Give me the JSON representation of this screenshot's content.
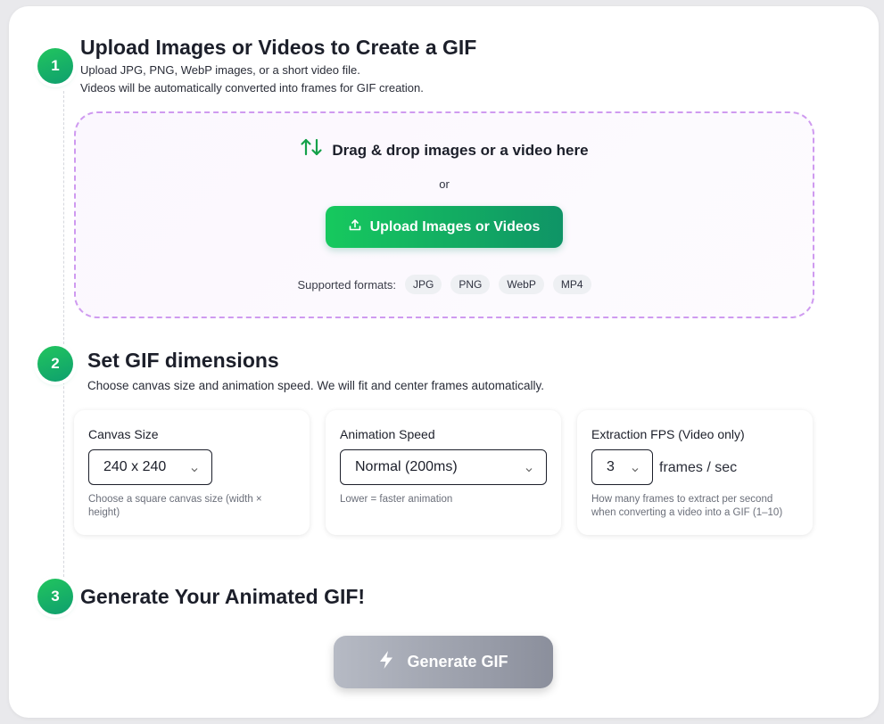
{
  "step1": {
    "number": "1",
    "title": "Upload Images or Videos to Create a GIF",
    "desc_line1": "Upload JPG, PNG, WebP images, or a short video file.",
    "desc_line2": "Videos will be automatically converted into frames for GIF creation.",
    "dropzone": {
      "title": "Drag & drop images or a video here",
      "or_text": "or",
      "upload_button": "Upload Images or Videos",
      "formats_label": "Supported formats:",
      "formats": [
        "JPG",
        "PNG",
        "WebP",
        "MP4"
      ]
    }
  },
  "step2": {
    "number": "2",
    "title": "Set GIF dimensions",
    "desc": "Choose canvas size and animation speed. We will fit and center frames automatically.",
    "canvas": {
      "label": "Canvas Size",
      "value": "240 x 240",
      "help_line1": "Choose a square canvas size (width ×",
      "help_line2": "height)"
    },
    "speed": {
      "label": "Animation Speed",
      "value": "Normal (200ms)",
      "help": "Lower = faster animation"
    },
    "fps": {
      "label": "Extraction FPS (Video only)",
      "value": "3",
      "unit": "frames / sec",
      "help_line1": "How many frames to extract per second",
      "help_line2": "when converting a video into a GIF (1–10)"
    }
  },
  "step3": {
    "number": "3",
    "title": "Generate Your Animated GIF!",
    "button": "Generate GIF"
  },
  "colors": {
    "accent_green": "#16c95e",
    "accent_green_dark": "#0f9466",
    "dropzone_border": "#cf9af0",
    "disabled_button": "#9a9eaa"
  },
  "icons": {
    "dropzone_icon": "swap-arrows-icon",
    "upload_icon": "upload-icon",
    "generate_icon": "lightning-bolt-icon",
    "select_icon": "chevron-down-icon"
  }
}
